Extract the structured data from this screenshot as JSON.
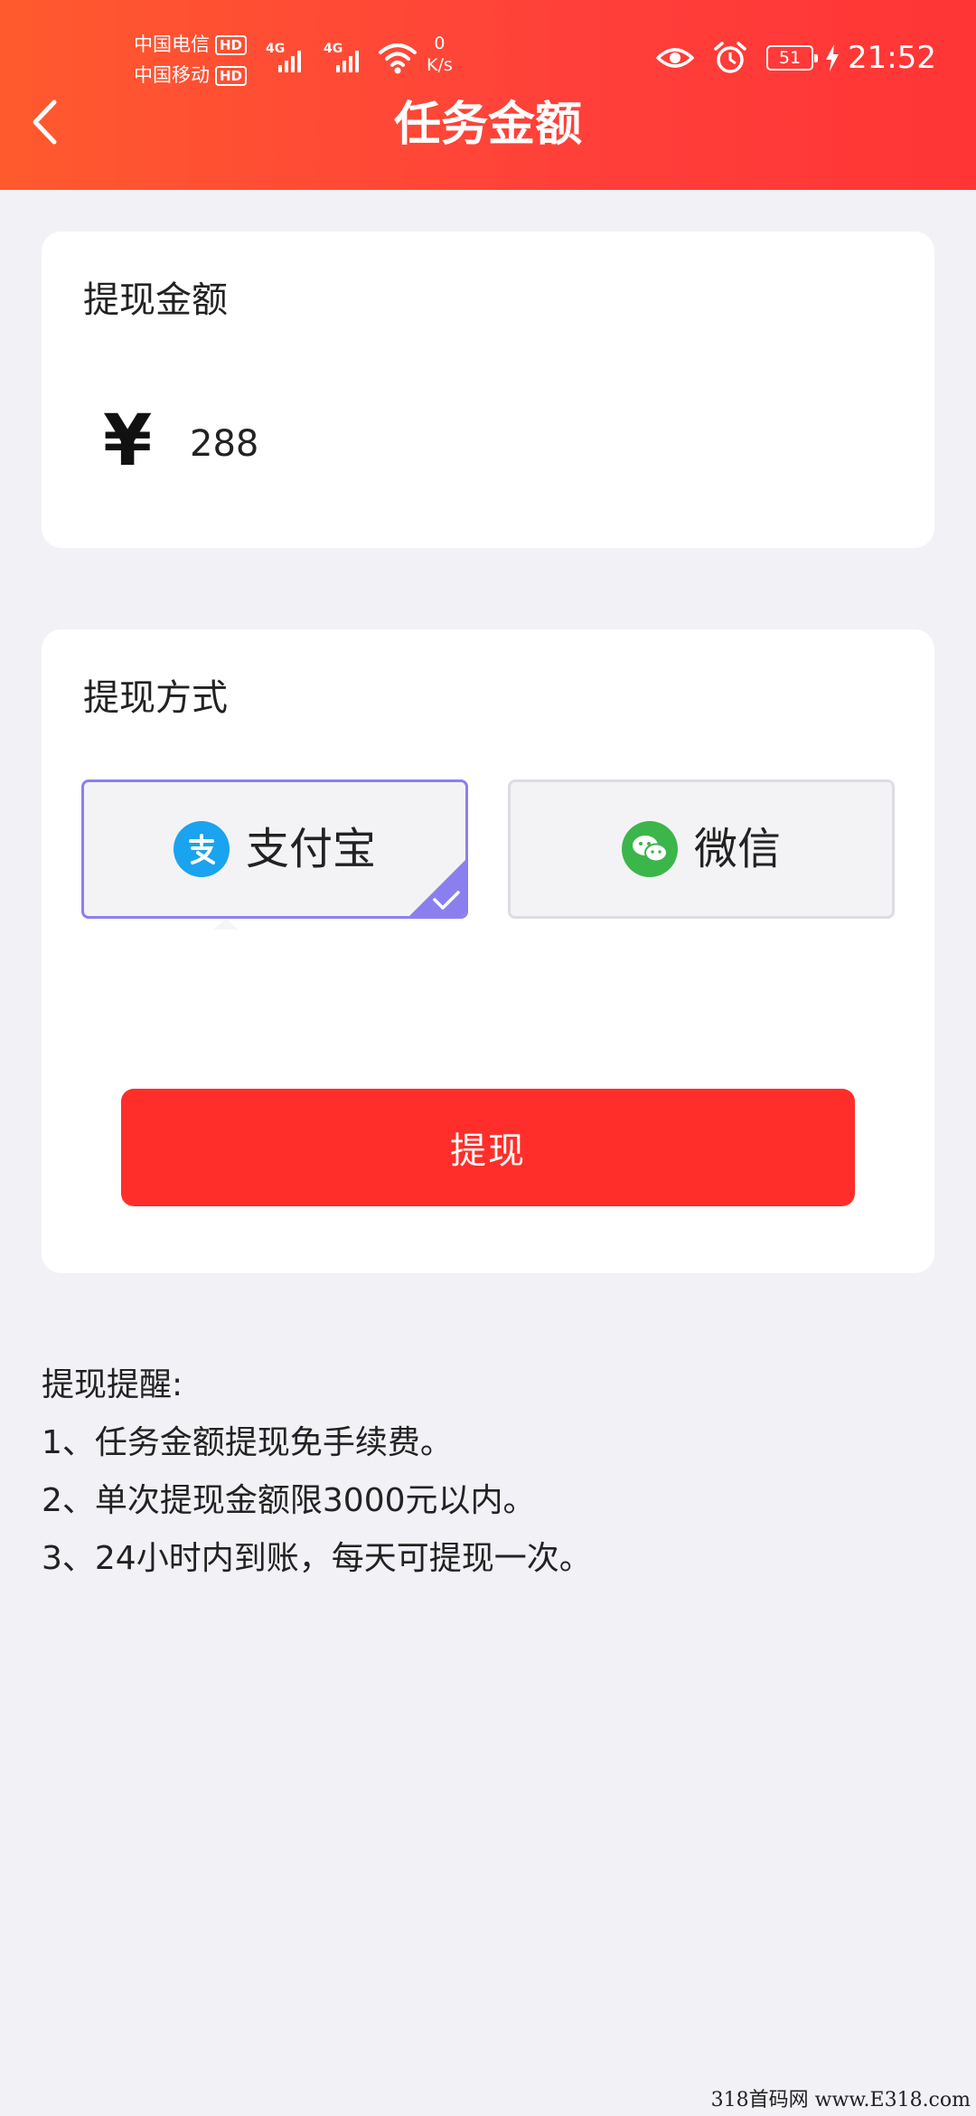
{
  "status_bar": {
    "carrier1": "中国电信",
    "carrier2": "中国移动",
    "hd": "HD",
    "network": "4G",
    "net_speed_value": "0",
    "net_speed_unit": "K/s",
    "battery": "51",
    "time": "21:52"
  },
  "header": {
    "title": "任务金额"
  },
  "amount_card": {
    "title": "提现金额",
    "currency": "¥",
    "amount": "288"
  },
  "method_card": {
    "title": "提现方式",
    "options": [
      {
        "label": "支付宝",
        "selected": true
      },
      {
        "label": "微信",
        "selected": false
      }
    ],
    "submit_label": "提现"
  },
  "notes": {
    "title": "提现提醒:",
    "items": [
      "1、任务金额提现免手续费。",
      "2、单次提现金额限3000元以内。",
      "3、24小时内到账，每天可提现一次。"
    ]
  },
  "watermark": "318首码网 www.E318.com",
  "colors": {
    "header_start": "#ff5a2e",
    "header_end": "#ff3535",
    "button": "#ff2e2a",
    "selected_border": "#8b7ff0",
    "alipay_blue": "#1aa3ee",
    "wechat_green": "#3bb64a"
  }
}
